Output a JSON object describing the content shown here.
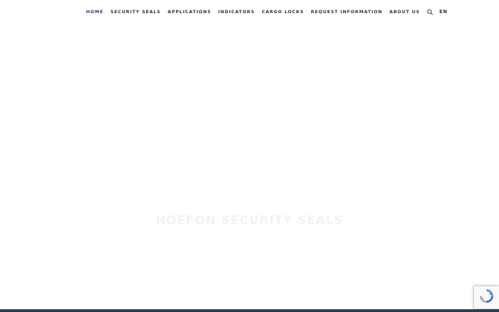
{
  "nav": {
    "items": [
      {
        "label": "HOME",
        "active": true
      },
      {
        "label": "SECURITY SEALS",
        "active": false
      },
      {
        "label": "APPLICATIONS",
        "active": false
      },
      {
        "label": "INDICATORS",
        "active": false
      },
      {
        "label": "CARGO LOCKS",
        "active": false
      },
      {
        "label": "REQUEST INFORMATION",
        "active": false
      },
      {
        "label": "ABOUT US",
        "active": false
      }
    ],
    "search_icon": "search-icon",
    "language": "EN"
  },
  "hero": {
    "title": "HOEFON SECURITY SEALS"
  },
  "colors": {
    "accent": "#2c3e6b",
    "nav_text": "#333333",
    "footer": "#2b3a55",
    "hero_title": "#f1f2f5"
  },
  "widgets": {
    "recaptcha_icon": "recaptcha-icon"
  }
}
